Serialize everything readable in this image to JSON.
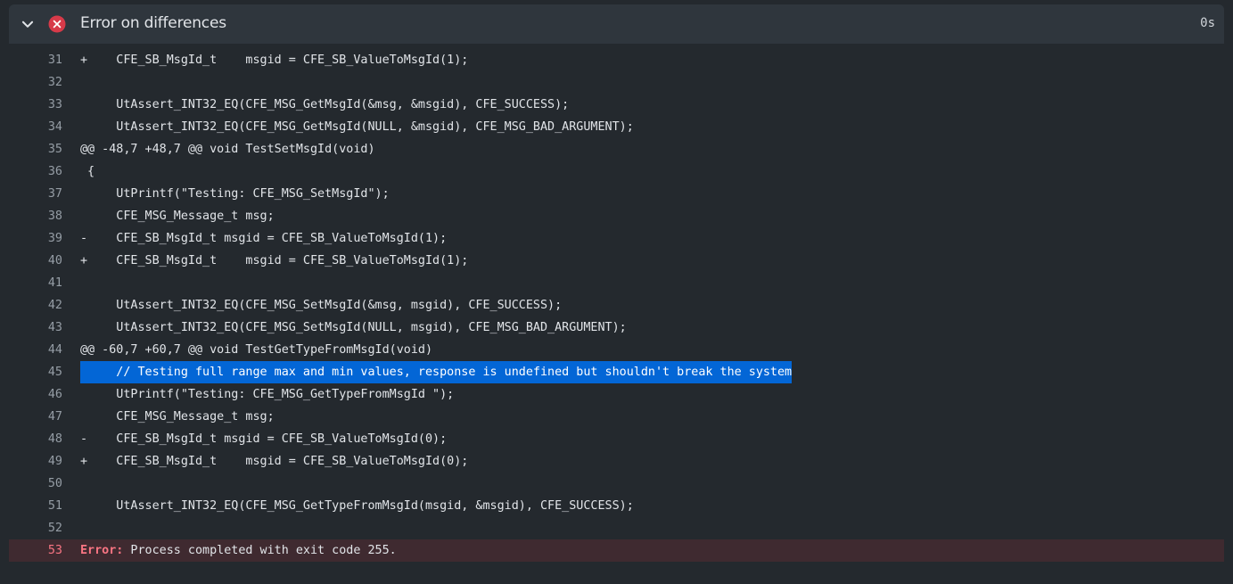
{
  "step": {
    "title": "Error on differences",
    "duration": "0s",
    "status": "failed"
  },
  "colors": {
    "error_red": "#d73a49",
    "highlight_blue": "#0366d6",
    "error_bg": "#3f2a30"
  },
  "lines": [
    {
      "num": "31",
      "text": "+    CFE_SB_MsgId_t    msgid = CFE_SB_ValueToMsgId(1);"
    },
    {
      "num": "32",
      "text": ""
    },
    {
      "num": "33",
      "text": "     UtAssert_INT32_EQ(CFE_MSG_GetMsgId(&msg, &msgid), CFE_SUCCESS);"
    },
    {
      "num": "34",
      "text": "     UtAssert_INT32_EQ(CFE_MSG_GetMsgId(NULL, &msgid), CFE_MSG_BAD_ARGUMENT);"
    },
    {
      "num": "35",
      "text": "@@ -48,7 +48,7 @@ void TestSetMsgId(void)"
    },
    {
      "num": "36",
      "text": " {"
    },
    {
      "num": "37",
      "text": "     UtPrintf(\"Testing: CFE_MSG_SetMsgId\");"
    },
    {
      "num": "38",
      "text": "     CFE_MSG_Message_t msg;"
    },
    {
      "num": "39",
      "text": "-    CFE_SB_MsgId_t msgid = CFE_SB_ValueToMsgId(1);"
    },
    {
      "num": "40",
      "text": "+    CFE_SB_MsgId_t    msgid = CFE_SB_ValueToMsgId(1);"
    },
    {
      "num": "41",
      "text": ""
    },
    {
      "num": "42",
      "text": "     UtAssert_INT32_EQ(CFE_MSG_SetMsgId(&msg, msgid), CFE_SUCCESS);"
    },
    {
      "num": "43",
      "text": "     UtAssert_INT32_EQ(CFE_MSG_SetMsgId(NULL, msgid), CFE_MSG_BAD_ARGUMENT);"
    },
    {
      "num": "44",
      "text": "@@ -60,7 +60,7 @@ void TestGetTypeFromMsgId(void)"
    },
    {
      "num": "45",
      "text": "     // Testing full range max and min values, response is undefined but shouldn't break the system",
      "highlighted": true
    },
    {
      "num": "46",
      "text": "     UtPrintf(\"Testing: CFE_MSG_GetTypeFromMsgId \");"
    },
    {
      "num": "47",
      "text": "     CFE_MSG_Message_t msg;"
    },
    {
      "num": "48",
      "text": "-    CFE_SB_MsgId_t msgid = CFE_SB_ValueToMsgId(0);"
    },
    {
      "num": "49",
      "text": "+    CFE_SB_MsgId_t    msgid = CFE_SB_ValueToMsgId(0);"
    },
    {
      "num": "50",
      "text": ""
    },
    {
      "num": "51",
      "text": "     UtAssert_INT32_EQ(CFE_MSG_GetTypeFromMsgId(msgid, &msgid), CFE_SUCCESS);"
    },
    {
      "num": "52",
      "text": ""
    }
  ],
  "error_line": {
    "num": "53",
    "prefix": "Error:",
    "text": " Process completed with exit code 255."
  }
}
